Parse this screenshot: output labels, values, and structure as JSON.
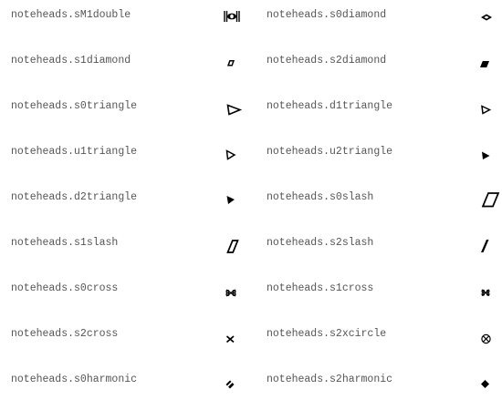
{
  "rows": [
    {
      "left": {
        "name": "noteheads.sM1double",
        "icon": "breve-double-notehead-icon"
      },
      "right": {
        "name": "noteheads.s0diamond",
        "icon": "whole-diamond-notehead-icon"
      }
    },
    {
      "left": {
        "name": "noteheads.s1diamond",
        "icon": "half-diamond-notehead-icon"
      },
      "right": {
        "name": "noteheads.s2diamond",
        "icon": "filled-diamond-notehead-icon"
      }
    },
    {
      "left": {
        "name": "noteheads.s0triangle",
        "icon": "whole-triangle-notehead-icon"
      },
      "right": {
        "name": "noteheads.d1triangle",
        "icon": "half-triangle-down-notehead-icon"
      }
    },
    {
      "left": {
        "name": "noteheads.u1triangle",
        "icon": "half-triangle-up-notehead-icon"
      },
      "right": {
        "name": "noteheads.u2triangle",
        "icon": "filled-triangle-up-notehead-icon"
      }
    },
    {
      "left": {
        "name": "noteheads.d2triangle",
        "icon": "filled-triangle-down-notehead-icon"
      },
      "right": {
        "name": "noteheads.s0slash",
        "icon": "whole-slash-notehead-icon"
      }
    },
    {
      "left": {
        "name": "noteheads.s1slash",
        "icon": "half-slash-notehead-icon"
      },
      "right": {
        "name": "noteheads.s2slash",
        "icon": "filled-slash-notehead-icon"
      }
    },
    {
      "left": {
        "name": "noteheads.s0cross",
        "icon": "whole-cross-notehead-icon"
      },
      "right": {
        "name": "noteheads.s1cross",
        "icon": "half-cross-notehead-icon"
      }
    },
    {
      "left": {
        "name": "noteheads.s2cross",
        "icon": "filled-cross-notehead-icon"
      },
      "right": {
        "name": "noteheads.s2xcircle",
        "icon": "x-circle-notehead-icon"
      }
    },
    {
      "left": {
        "name": "noteheads.s0harmonic",
        "icon": "whole-harmonic-notehead-icon"
      },
      "right": {
        "name": "noteheads.s2harmonic",
        "icon": "filled-harmonic-notehead-icon"
      }
    }
  ]
}
